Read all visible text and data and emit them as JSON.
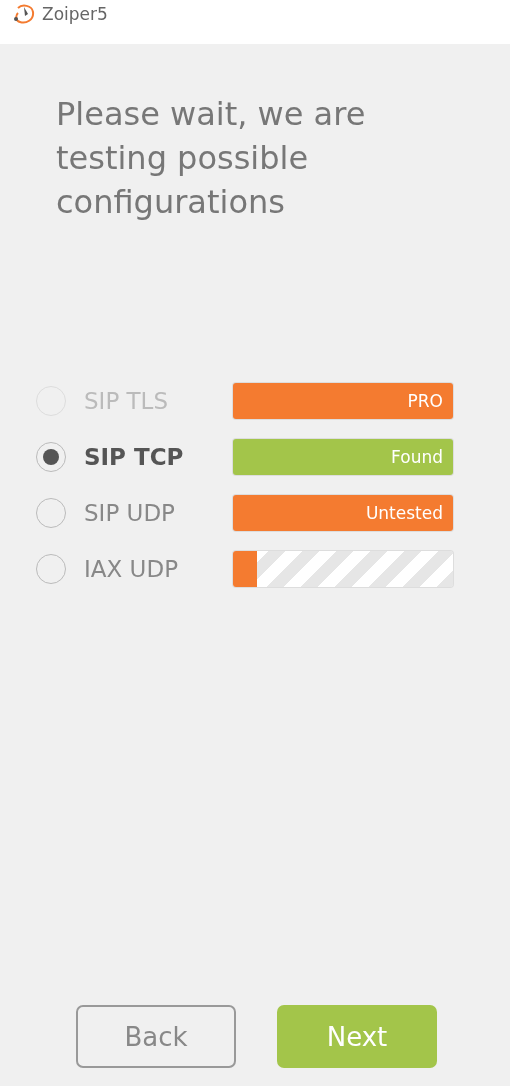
{
  "window": {
    "title": "Zoiper5"
  },
  "heading": "Please wait, we are testing possible configurations",
  "protocols": [
    {
      "label": "SIP TLS",
      "selected": false,
      "disabled": true,
      "kind": "status",
      "color": "#f47b30",
      "text": "PRO"
    },
    {
      "label": "SIP TCP",
      "selected": true,
      "disabled": false,
      "kind": "status",
      "color": "#a3c54a",
      "text": "Found"
    },
    {
      "label": "SIP UDP",
      "selected": false,
      "disabled": false,
      "kind": "status",
      "color": "#f47b30",
      "text": "Untested"
    },
    {
      "label": "IAX UDP",
      "selected": false,
      "disabled": false,
      "kind": "progress",
      "level": 0.11
    }
  ],
  "buttons": [
    {
      "label": "Back",
      "kind": "secondary"
    },
    {
      "label": "Next",
      "kind": "primary"
    }
  ]
}
